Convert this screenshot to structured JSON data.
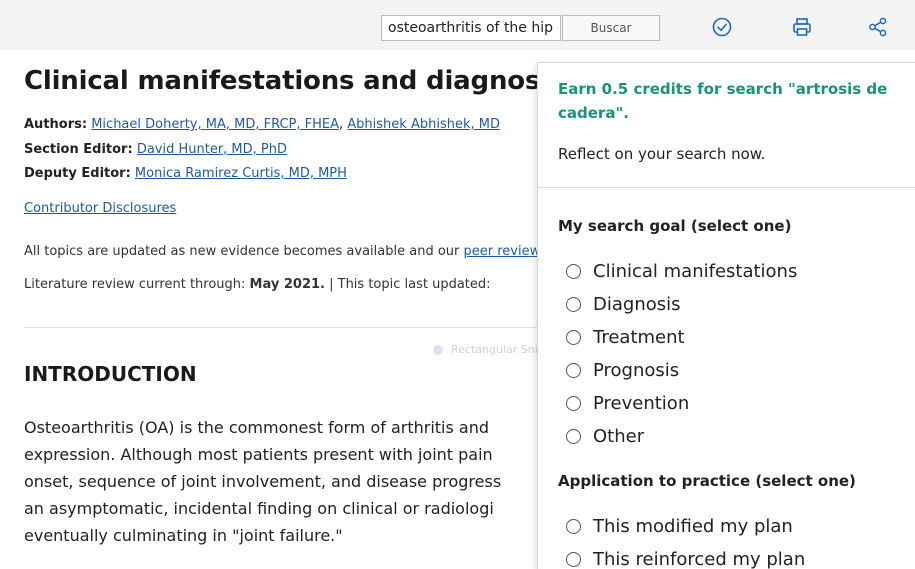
{
  "toolbar": {
    "search_value": "osteoarthritis of the hip",
    "search_button": "Buscar",
    "icons": [
      "check-circle-icon",
      "print-icon",
      "share-icon"
    ],
    "accent_color": "#1f6bb5"
  },
  "article": {
    "title": "Clinical manifestations and diagnosis of osteoarthritis",
    "authors_label": "Authors:",
    "authors": [
      "Michael Doherty, MA, MD, FRCP, FHEA",
      "Abhishek Abhishek, MD"
    ],
    "section_editor_label": "Section Editor:",
    "section_editor": "David Hunter, MD, PhD",
    "deputy_editor_label": "Deputy Editor:",
    "deputy_editor": "Monica Ramirez Curtis, MD, MPH",
    "contributor_disclosures": "Contributor Disclosures",
    "update_text": "All topics are updated as new evidence becomes available and our ",
    "update_link": "peer review process is complete.",
    "review_label": "Literature review current through: ",
    "review_date": "May 2021.",
    "review_rest": " | This topic last updated: ",
    "intro_heading": "INTRODUCTION",
    "intro_lines": [
      "Osteoarthritis (OA) is the commonest form of arthritis and",
      "expression. Although most patients present with joint pain",
      "onset, sequence of joint involvement, and disease progress",
      "an asymptomatic, incidental finding on clinical or radiologi",
      "eventually culminating in \"joint failure.\""
    ]
  },
  "overlay": {
    "snip_label": "Rectangular Snip"
  },
  "panel": {
    "credits_text": "Earn 0.5 credits for search \"artrosis de cadera\".",
    "reflect_text": "Reflect on your search now.",
    "credits_color": "#1b9277",
    "goal_title": "My search goal (select one)",
    "goal_options": [
      "Clinical manifestations",
      "Diagnosis",
      "Treatment",
      "Prognosis",
      "Prevention",
      "Other"
    ],
    "practice_title": "Application to practice (select one)",
    "practice_options": [
      "This modified my plan",
      "This reinforced my plan"
    ]
  }
}
